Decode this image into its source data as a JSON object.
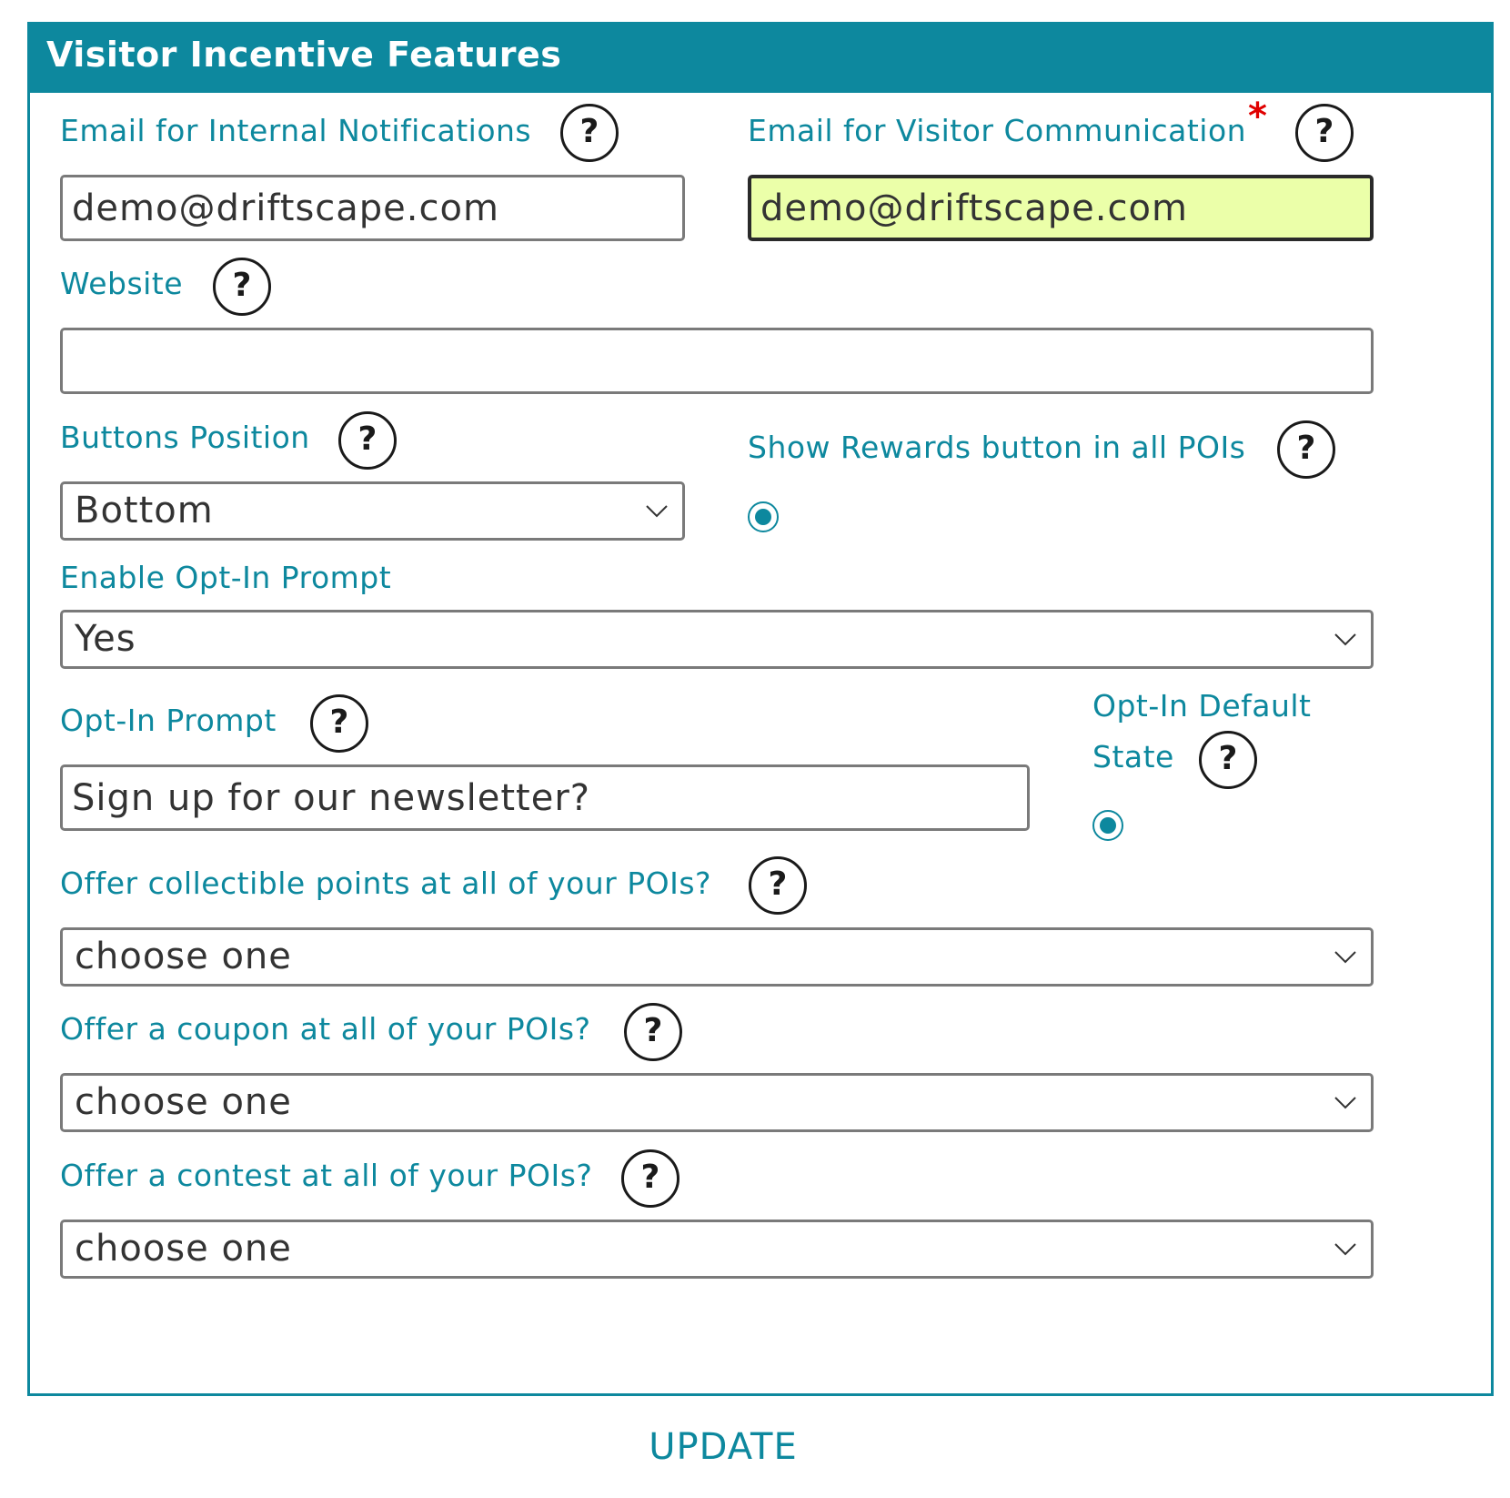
{
  "panel": {
    "title": "Visitor Incentive Features"
  },
  "help_icon_glyph": "?",
  "required_marker": "*",
  "fields": {
    "internal_email": {
      "label": "Email for Internal Notifications",
      "value": "demo@driftscape.com"
    },
    "visitor_email": {
      "label": "Email for Visitor Communication",
      "value": "demo@driftscape.com",
      "required": true
    },
    "website": {
      "label": "Website",
      "value": ""
    },
    "buttons_position": {
      "label": "Buttons Position",
      "value": "Bottom"
    },
    "show_rewards": {
      "label": "Show Rewards button in all POIs",
      "checked": true
    },
    "enable_optin": {
      "label": "Enable Opt-In Prompt",
      "value": "Yes"
    },
    "optin_prompt": {
      "label": "Opt-In Prompt",
      "value": "Sign up for our newsletter?"
    },
    "optin_default": {
      "label_line1": "Opt-In Default",
      "label_line2": "State",
      "checked": true
    },
    "collectible_points": {
      "label": "Offer collectible points at all of your POIs?",
      "value": "choose one"
    },
    "coupon": {
      "label": "Offer a coupon at all of your POIs?",
      "value": "choose one"
    },
    "contest": {
      "label": "Offer a contest at all of your POIs?",
      "value": "choose one"
    }
  },
  "actions": {
    "update_label": "UPDATE"
  },
  "colors": {
    "accent": "#0d889e",
    "required": "#e00000",
    "highlight_field": "#ebffa9"
  },
  "icons": {
    "help": "question-circle-icon",
    "dropdown": "chevron-down-icon"
  }
}
